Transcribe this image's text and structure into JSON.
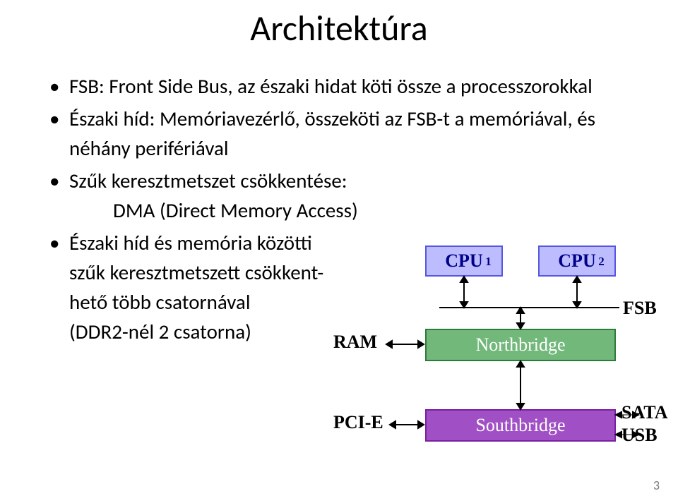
{
  "title": "Architektúra",
  "bullets": {
    "b1": "FSB: Front Side Bus, az északi hidat köti össze a processzorokkal",
    "b2": "Északi híd: Memóriavezérlő, összeköti az FSB-t a memóriával, és néhány perifériával",
    "b3": "Szűk keresztmetszet csökkentése:",
    "b3_sub": "DMA (Direct Memory Access)",
    "b4": "Északi híd és memória közötti",
    "b4_line2": "szűk keresztmetszett csökkent-",
    "b4_line3": "hető több csatornával",
    "b4_line4": "(DDR2-nél 2 csatorna)"
  },
  "diagram": {
    "cpu_base": "CPU",
    "cpu_sub1": "1",
    "cpu_sub2": "2",
    "northbridge": "Northbridge",
    "southbridge": "Southbridge",
    "ram": "RAM",
    "pcie": "PCI-E",
    "fsb": "FSB",
    "sata": "SATA",
    "usb": "USB"
  },
  "page_number": "3"
}
